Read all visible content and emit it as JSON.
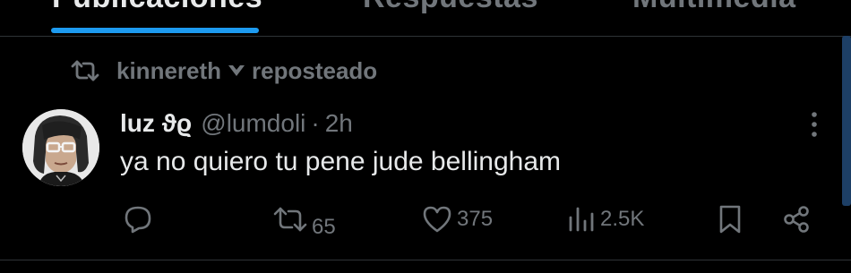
{
  "tabs": [
    {
      "label": "Publicaciones",
      "active": true
    },
    {
      "label": "Respuestas",
      "active": false
    },
    {
      "label": "Multimedia",
      "active": false
    }
  ],
  "repost": {
    "user": "kinnereth",
    "action": "reposteado",
    "icon": "repost-icon"
  },
  "tweet": {
    "display_name": "luz ϑϱ",
    "handle": "@lumdoli",
    "separator": "·",
    "time": "2h",
    "text": "ya no quiero tu pene jude bellingham"
  },
  "actions": {
    "reply_count": "",
    "repost_count": "65",
    "like_count": "375",
    "view_count": "2.5K"
  },
  "colors": {
    "background": "#000000",
    "text": "#e7e9ea",
    "muted": "#71767b",
    "accent": "#1d9bf0",
    "divider": "#2f3336"
  }
}
